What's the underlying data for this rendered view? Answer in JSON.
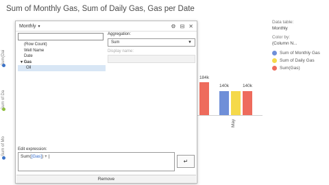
{
  "page": {
    "title": "Sum of Monthly Gas, Sum of Daily Gas, Gas per Date"
  },
  "rails": [
    {
      "label": "Sum(Dai",
      "color": "#3b73c8"
    },
    {
      "label": "Sum of Da",
      "color": "#8fbf3f"
    },
    {
      "label": "Sum of Mo",
      "color": "#3b73c8"
    }
  ],
  "background_chart": {
    "bar_labels": [
      "184k",
      "140k",
      "140k"
    ],
    "x_tick": "May",
    "colors": {
      "blue": "#6f8fd8",
      "yellow": "#f5d94a",
      "red": "#ee6b5c"
    }
  },
  "legend": {
    "data_table_label": "Data table:",
    "data_table_value": "Monthly",
    "color_by_label": "Color by:",
    "color_by_value": "(Column N...",
    "items": [
      {
        "label": "Sum of Monthly Gas",
        "color": "#6f8fd8"
      },
      {
        "label": "Sum of Daily Gas",
        "color": "#f5d94a"
      },
      {
        "label": "Sum(Gas)",
        "color": "#ee6b5c"
      }
    ]
  },
  "popup": {
    "title": "Monthly",
    "search_value": "",
    "columns": [
      {
        "label": "(Row Count)",
        "kind": "item"
      },
      {
        "label": "Well Name",
        "kind": "item"
      },
      {
        "label": "Date",
        "kind": "item"
      },
      {
        "label": "Gas",
        "kind": "group"
      },
      {
        "label": "Oil",
        "kind": "selected"
      }
    ],
    "aggregation_label": "Aggregation:",
    "aggregation_value": "Sum",
    "display_name_label": "Display name:",
    "edit_expression_label": "Edit expression:",
    "expression_prefix": "Sum(",
    "expression_token": "[Gas]",
    "expression_suffix": ") + |",
    "insert_symbol": "↵",
    "remove_label": "Remove"
  }
}
